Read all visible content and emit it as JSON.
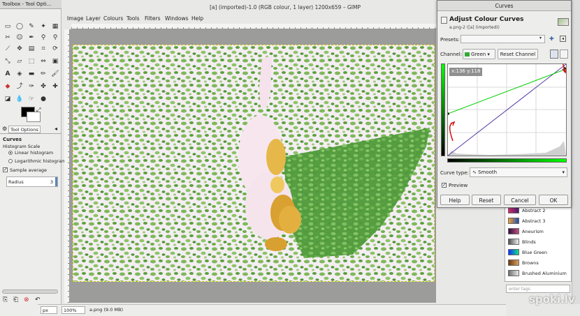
{
  "toolbox": {
    "title": "Toolbox - Tool Opti...",
    "tab_label": "Tool Options",
    "options_title": "Curves",
    "histogram_scale_label": "Histogram Scale",
    "linear_label": "Linear histogram",
    "log_label": "Logarithmic histogram",
    "sample_average_label": "Sample average",
    "radius_label": "Radius",
    "radius_value": "3"
  },
  "window": {
    "title": "[a] (imported)-1.0 (RGB colour, 1 layer) 1200x659 – GIMP",
    "menus": [
      "Image",
      "Layer",
      "Colours",
      "Tools",
      "Filters",
      "Windows",
      "Help"
    ]
  },
  "status": {
    "unit": "px",
    "zoom": "100%",
    "file_info": "a.png (9.0 MB)"
  },
  "curves": {
    "window_title": "Curves",
    "heading": "Adjust Colour Curves",
    "subheading": "a.png-2 ([a] (imported))",
    "presets_label": "Presets:",
    "channel_label": "Channel:",
    "channel_value": "Green",
    "reset_channel": "Reset Channel",
    "coord_readout": "x:136 y:118",
    "curve_type_label": "Curve type:",
    "curve_type_value": "Smooth",
    "preview_label": "Preview",
    "buttons": {
      "help": "Help",
      "reset": "Reset",
      "cancel": "Cancel",
      "ok": "OK"
    }
  },
  "gradients": {
    "items": [
      {
        "name": "Abstract 2",
        "colors": [
          "#d02d6a",
          "#4a1d6e"
        ]
      },
      {
        "name": "Abstract 3",
        "colors": [
          "#f0a030",
          "#2050b0"
        ]
      },
      {
        "name": "Aneurism",
        "colors": [
          "#301040",
          "#c05080"
        ]
      },
      {
        "name": "Blinds",
        "colors": [
          "#505050",
          "#f0f0f0"
        ]
      },
      {
        "name": "Blue Green",
        "colors": [
          "#1030ff",
          "#10e080"
        ]
      },
      {
        "name": "Browns",
        "colors": [
          "#6b3a12",
          "#d8a060"
        ]
      },
      {
        "name": "Brushed Aluminium",
        "colors": [
          "#707070",
          "#e8e8e8"
        ]
      }
    ],
    "tags_placeholder": "enter tags"
  },
  "watermark": "spoki.lv",
  "colors": {
    "green_channel": "#00cc00",
    "identity_line": "#5a3ea8",
    "annotation": "#d01010"
  }
}
